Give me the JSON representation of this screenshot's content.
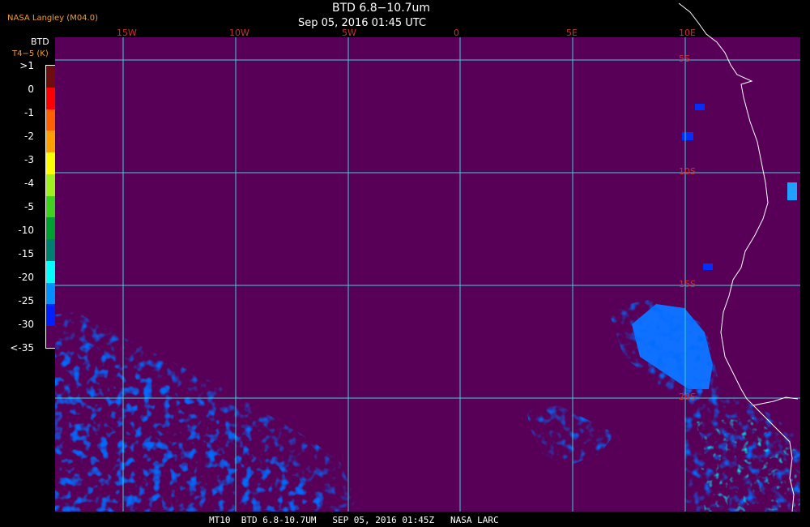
{
  "header": {
    "org": "NASA Langley (M04.0)",
    "title": "BTD 6.8−10.7um",
    "subtitle": "Sep 05, 2016 01:45 UTC"
  },
  "legend": {
    "title": "BTD",
    "unit": "T4−5 (K)",
    "entries": [
      {
        "label": ">1",
        "color": "#6e0d0d"
      },
      {
        "label": "0",
        "color": "#ff0000"
      },
      {
        "label": "-1",
        "color": "#ff6000"
      },
      {
        "label": "-2",
        "color": "#ffa000"
      },
      {
        "label": "-3",
        "color": "#ffff00"
      },
      {
        "label": "-4",
        "color": "#a0f020"
      },
      {
        "label": "-5",
        "color": "#40d020"
      },
      {
        "label": "-10",
        "color": "#00a030"
      },
      {
        "label": "-15",
        "color": "#008070"
      },
      {
        "label": "-20",
        "color": "#00ffff"
      },
      {
        "label": "-25",
        "color": "#0090ff"
      },
      {
        "label": "-30",
        "color": "#0020ff"
      },
      {
        "label": "<-35",
        "color": "#580058"
      }
    ]
  },
  "map": {
    "background_color": "#580058",
    "grid_color": "#40d0d0",
    "label_color": "#d03030",
    "coast_color": "#ffffff",
    "lon_labels": [
      "15W",
      "10W",
      "5W",
      "0",
      "5E",
      "10E"
    ],
    "lat_labels": [
      "5S",
      "10S",
      "15S",
      "20S"
    ]
  },
  "footer": {
    "text": "MT10  BTD 6.8-10.7UM   SEP 05, 2016 01:45Z   NASA LARC"
  }
}
